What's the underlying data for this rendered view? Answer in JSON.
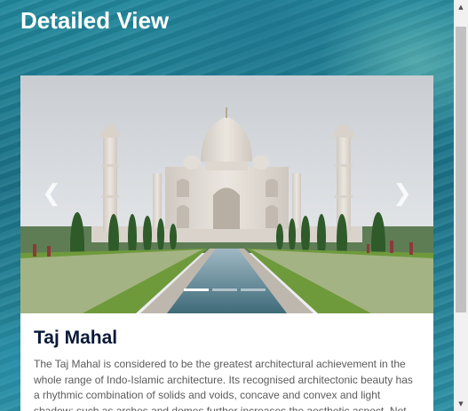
{
  "page": {
    "title": "Detailed View"
  },
  "carousel": {
    "prev_icon": "chevron-left-icon",
    "next_icon": "chevron-right-icon",
    "prev_glyph": "❮",
    "next_glyph": "❯",
    "slide_count": 3,
    "active_index": 0
  },
  "card": {
    "title": "Taj Mahal",
    "description": "The Taj Mahal is considered to be the greatest architectural achievement in the whole range of Indo-Islamic architecture. Its recognised architectonic beauty has a rhythmic combination of solids and voids, concave and convex and light shadow; such as arches and domes further increases the aesthetic aspect. Not"
  },
  "colors": {
    "title_text": "#0b1a3a",
    "body_text": "#5b5b5b",
    "background_water": "#1f7f93"
  },
  "scrollbar": {
    "up_glyph": "▲",
    "down_glyph": "▼"
  }
}
